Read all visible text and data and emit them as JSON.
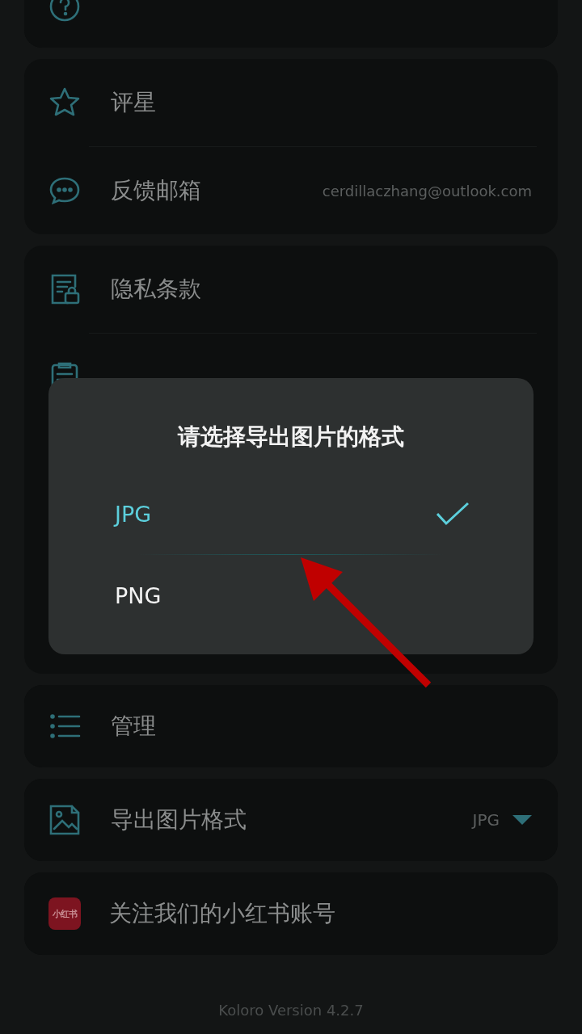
{
  "settings_groups": [
    {
      "items": [
        {
          "kind": "help"
        }
      ]
    },
    {
      "items": [
        {
          "kind": "star",
          "label": "评星"
        },
        {
          "kind": "chat",
          "label": "反馈邮箱",
          "value": "cerdillaczhang@outlook.com"
        }
      ]
    },
    {
      "items": [
        {
          "kind": "lock-doc",
          "label": "隐私条款"
        },
        {
          "kind": "clipboard"
        }
      ]
    },
    {
      "items": [
        {
          "kind": "list",
          "label": "管理"
        }
      ]
    },
    {
      "items": [
        {
          "kind": "image",
          "label": "导出图片格式",
          "value": "JPG",
          "dropdown": true
        }
      ]
    },
    {
      "items": [
        {
          "kind": "brand",
          "label": "关注我们的小红书账号",
          "icon_text": "小红书"
        }
      ]
    }
  ],
  "footer": "Koloro Version 4.2.7",
  "dialog": {
    "title": "请选择导出图片的格式",
    "options": [
      {
        "label": "JPG",
        "selected": true
      },
      {
        "label": "PNG",
        "selected": false
      }
    ]
  }
}
